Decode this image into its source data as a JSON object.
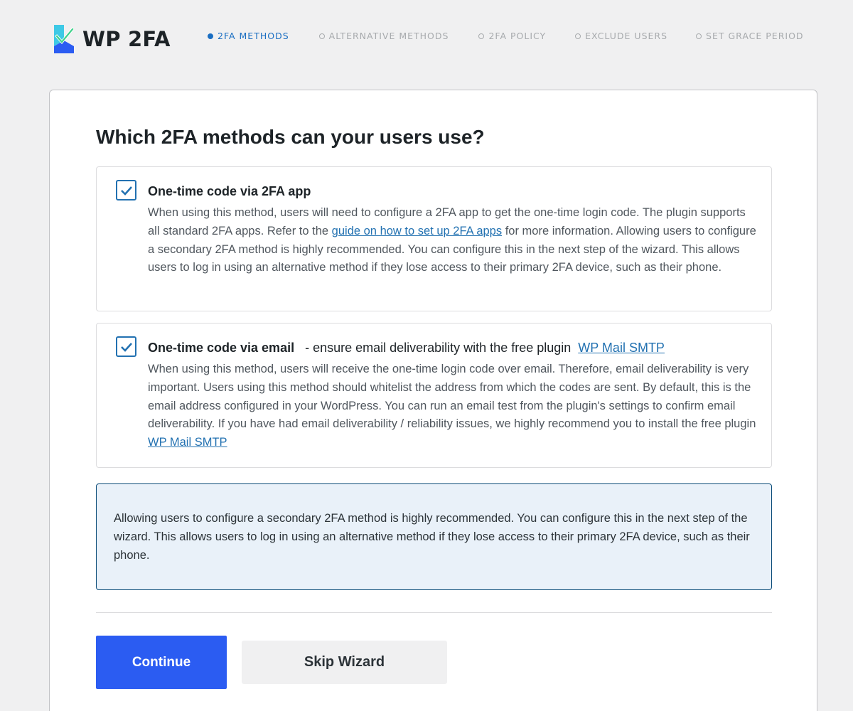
{
  "app": {
    "logo_text": "WP 2FA",
    "brand_colors": {
      "teal": "#3ec9e6",
      "blue": "#2b5cf2",
      "green": "#3fd28a"
    }
  },
  "steps": [
    {
      "label": "2FA METHODS",
      "active": true
    },
    {
      "label": "ALTERNATIVE METHODS",
      "active": false
    },
    {
      "label": "2FA POLICY",
      "active": false
    },
    {
      "label": "EXCLUDE USERS",
      "active": false
    },
    {
      "label": "SET GRACE PERIOD",
      "active": false
    }
  ],
  "card": {
    "title": "Which 2FA methods can your users use?",
    "methods": [
      {
        "checked": true,
        "title": "One-time code via 2FA app",
        "desc_part1": "When using this method, users will need to configure a 2FA app to get the one-time login code. The plugin supports all standard 2FA apps. Refer to the ",
        "link": "guide on how to set up 2FA apps",
        "desc_part2": " for more information. Allowing users to configure a secondary 2FA method is highly recommended. You can configure this in the next step of the wizard. This allows users to log in using an alternative method if they lose access to their primary 2FA device, such as their phone."
      },
      {
        "checked": true,
        "title": "One-time code via email",
        "title_suffix": " - ensure email deliverability with the free plugin",
        "title_link": "WP Mail SMTP",
        "desc_part1": "When using this method, users will receive the one-time login code over email. Therefore, email deliverability is very important. Users using this method should whitelist the address from which the codes are sent. By default, this is the email address configured in your WordPress. You can run an email test from the plugin's settings to confirm email deliverability. If you have had email deliverability / reliability issues, we highly recommend you to install the free plugin ",
        "link": "WP Mail SMTP"
      }
    ],
    "notice": "Allowing users to configure a secondary 2FA method is highly recommended. You can configure this in the next step of the wizard. This allows users to log in using an alternative method if they lose access to their primary 2FA device, such as their phone.",
    "continue_label": "Continue",
    "skip_label": "Skip Wizard"
  },
  "icons": {
    "checkbox": "checkmark-icon",
    "step": "dot-icon",
    "logo": "wp2fa-logo-icon"
  }
}
